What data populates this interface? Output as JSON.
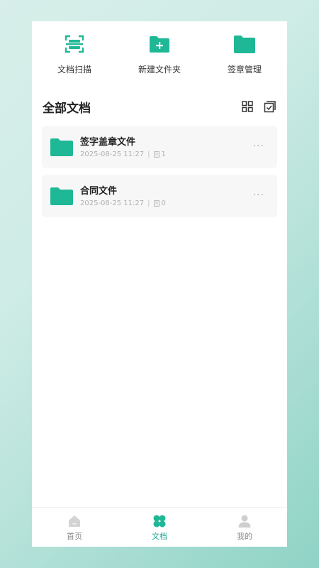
{
  "quick_actions": [
    {
      "label": "文档扫描",
      "icon": "scan-icon"
    },
    {
      "label": "新建文件夹",
      "icon": "new-folder-icon"
    },
    {
      "label": "签章管理",
      "icon": "folder-icon"
    }
  ],
  "section": {
    "title": "全部文档"
  },
  "folders": [
    {
      "name": "签字盖章文件",
      "date": "2025-08-25 11:27",
      "count": "1"
    },
    {
      "name": "合同文件",
      "date": "2025-08-25 11:27",
      "count": "0"
    }
  ],
  "more_label": "···",
  "separator": "|",
  "nav": [
    {
      "label": "首页",
      "icon": "home-icon"
    },
    {
      "label": "文档",
      "icon": "clover-icon",
      "active": true
    },
    {
      "label": "我的",
      "icon": "user-icon"
    }
  ],
  "colors": {
    "accent": "#1fb896",
    "accent_dark": "#169c80",
    "inactive": "#c8c8c8"
  }
}
